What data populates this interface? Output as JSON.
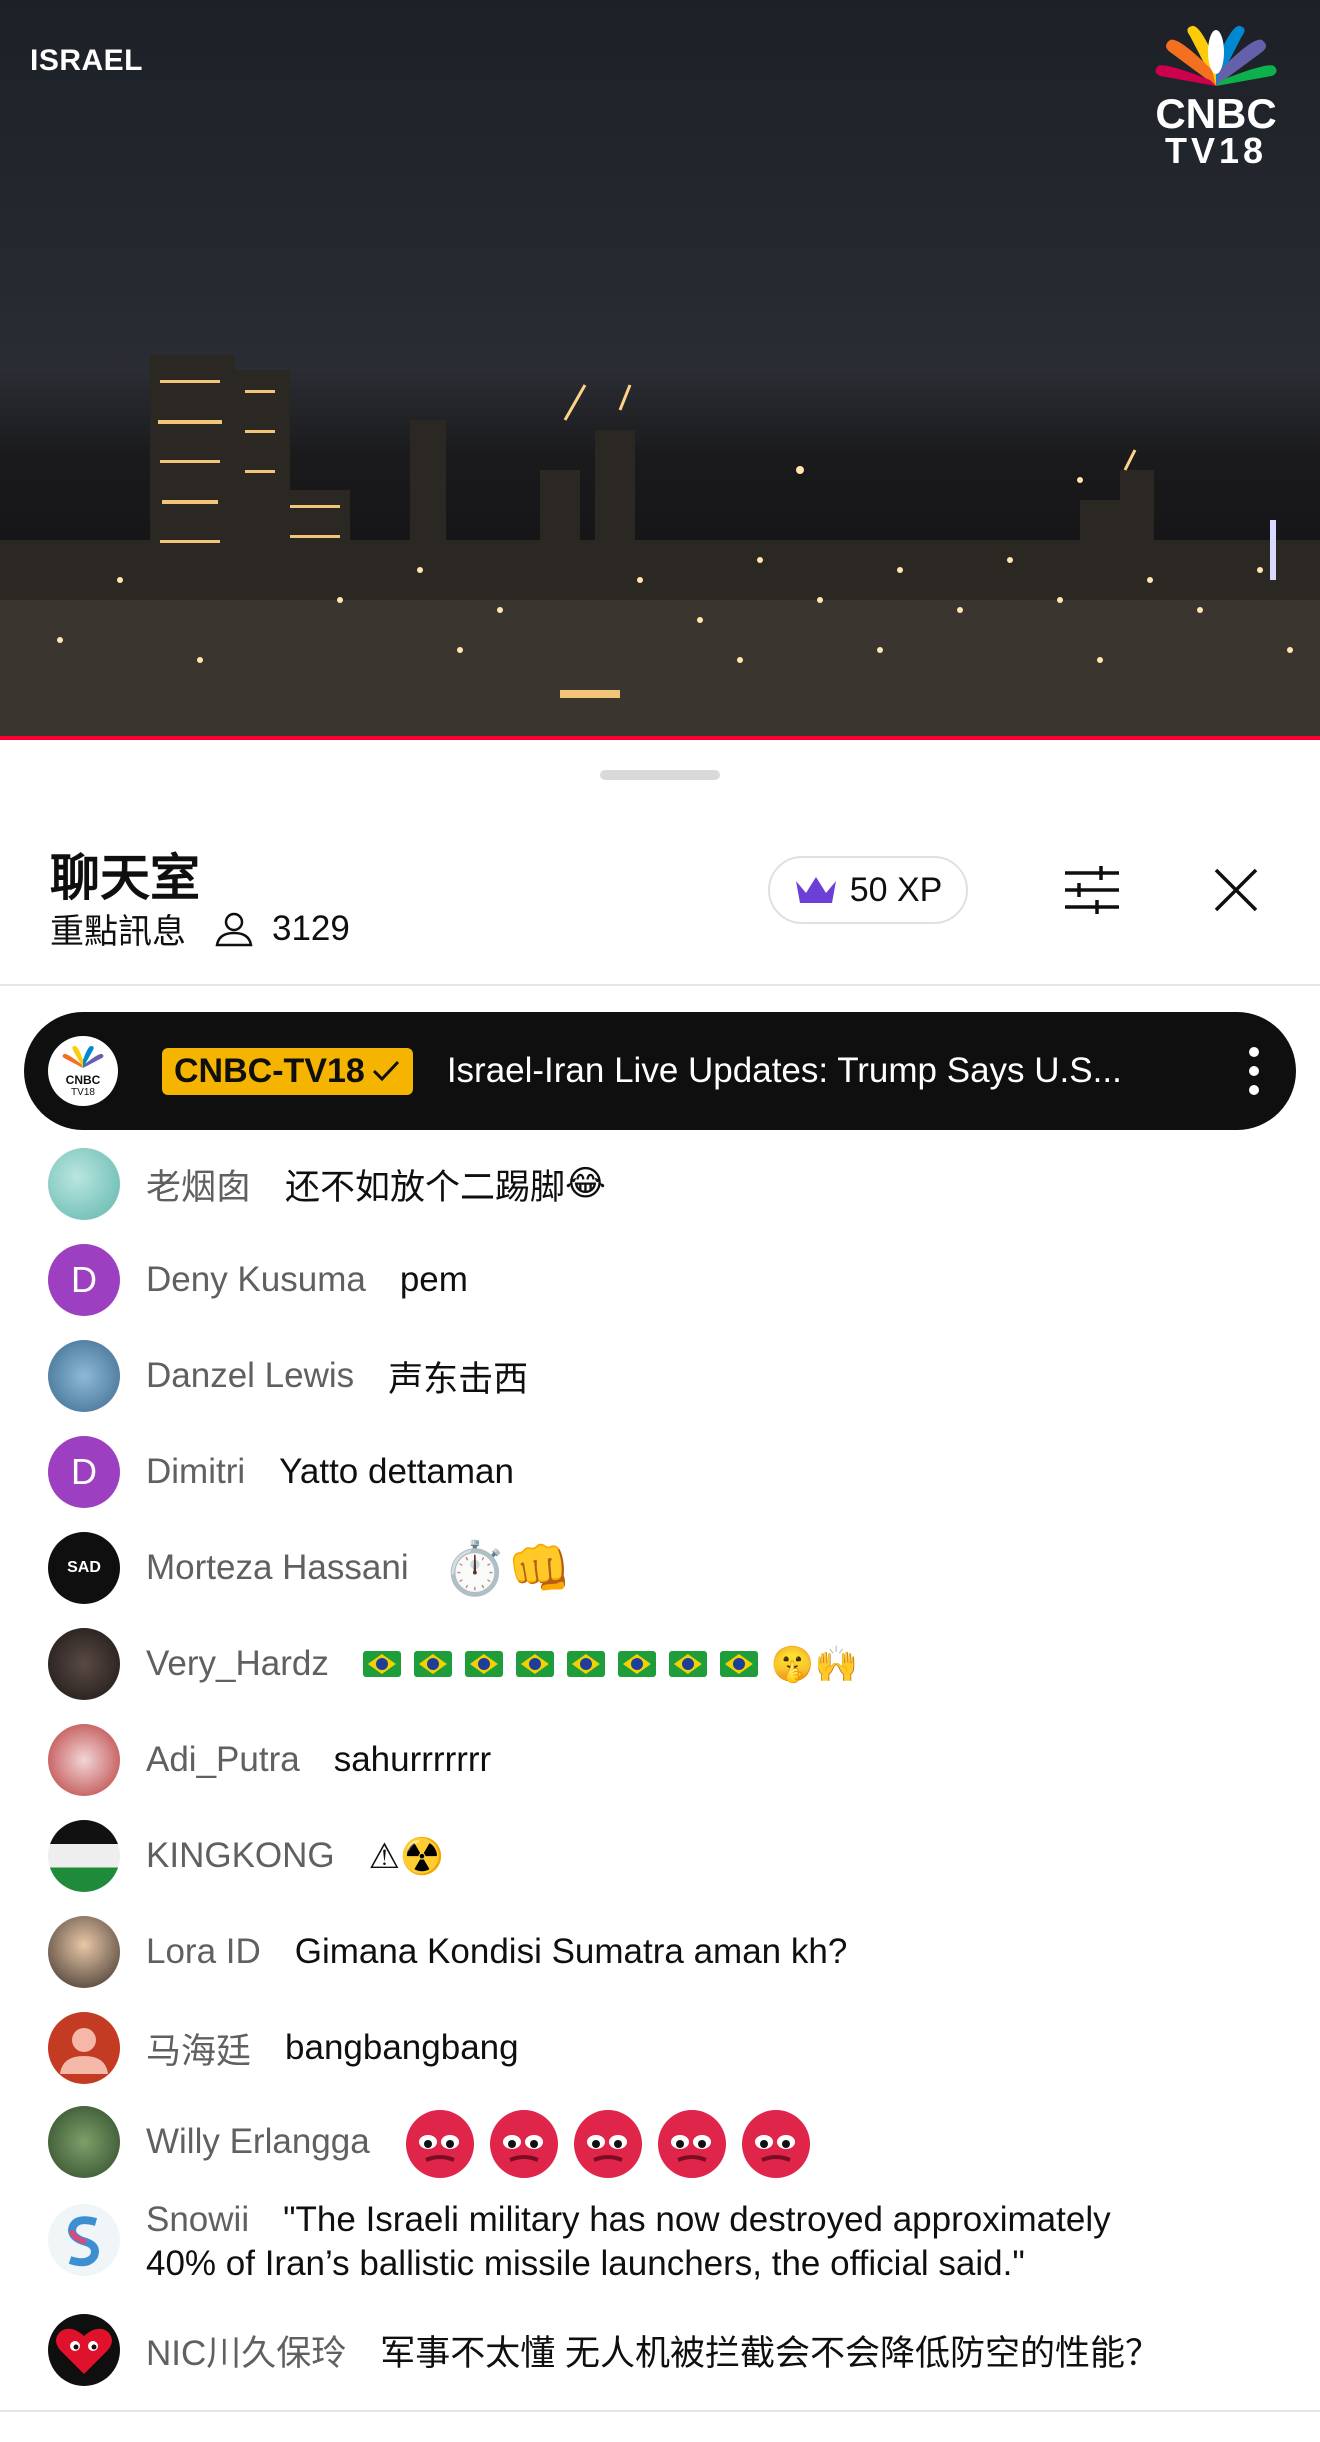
{
  "video": {
    "location_tag": "ISRAEL",
    "channel_logo": {
      "line1": "CNBC",
      "line2": "TV18"
    },
    "progress_fraction": 1.0
  },
  "chat": {
    "title": "聊天室",
    "mode_label": "重點訊息",
    "viewer_count": "3129",
    "xp_label": "50 XP",
    "pinned": {
      "channel_badge": "CNBC-TV18",
      "text": "Israel-Iran Live Updates: Trump Says U.S..."
    },
    "messages": [
      {
        "author": "老烟囱",
        "text": "还不如放个二踢脚",
        "emoji_suffix": "😂"
      },
      {
        "author": "Deny Kusuma",
        "text": "pem",
        "avatar_letter": "D"
      },
      {
        "author": "Danzel Lewis",
        "text": "声东击西"
      },
      {
        "author": "Dimitri",
        "text": "Yatto dettaman",
        "avatar_letter": "D"
      },
      {
        "author": "Morteza Hassani",
        "text": "",
        "emoji": "⏱️👊"
      },
      {
        "author": "Very_Hardz",
        "text": "",
        "flag_count": 8,
        "emoji_suffix": "🤫🙌"
      },
      {
        "author": "Adi_Putra",
        "text": "sahurrrrrrr"
      },
      {
        "author": "KINGKONG",
        "text": "⚠☢️"
      },
      {
        "author": "Lora ID",
        "text": "Gimana Kondisi Sumatra aman kh?"
      },
      {
        "author": "马海廷",
        "text": "bangbangbang"
      },
      {
        "author": "Willy Erlangga",
        "text": "",
        "custom_emoji_count": 5
      },
      {
        "author": "Snowii",
        "text_line1": "\"The Israeli military has now destroyed approximately",
        "text_line2": "40% of Iran’s ballistic missile launchers, the official said.\""
      },
      {
        "author": "NIC川久保玲",
        "text": "军事不太懂 无人机被拦截会不会降低防空的性能？"
      }
    ]
  },
  "colors": {
    "accent_red": "#ff0033",
    "badge_gold": "#f4b400",
    "crown_purple": "#6c3fd6",
    "avatar_purple": "#9c3fc1",
    "author_gray": "#606060"
  }
}
